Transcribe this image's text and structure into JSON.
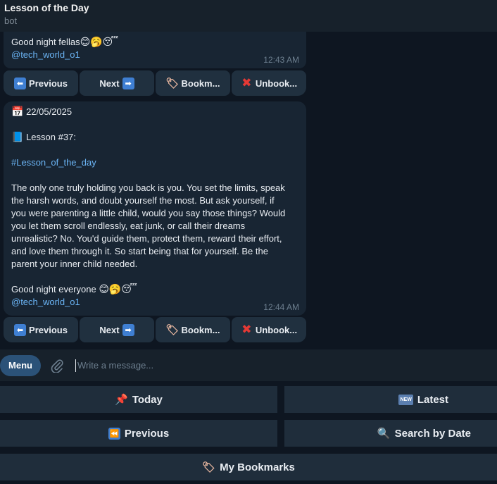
{
  "header": {
    "title": "Lesson of the Day",
    "subtitle": "bot"
  },
  "messages": [
    {
      "lines": [
        "Good night fellas"
      ],
      "emoji": "😊🥱😴",
      "mention": "@tech_world_o1",
      "time": "12:43 AM"
    },
    {
      "date_emoji": "📅",
      "date": "22/05/2025",
      "lesson_emoji": "📘",
      "lesson": "Lesson #37:",
      "hashtag": "#Lesson_of_the_day",
      "body": [
        "The only one truly holding you back is you. You set the limits, speak",
        "the harsh words, and doubt yourself the most. But ask yourself, if",
        "you were parenting a little child, would you say those things? Would",
        "you let them scroll endlessly, eat junk, or call their dreams",
        "unrealistic? No. You'd guide them, protect them, reward their effort,",
        "and love them through it. So start being that for yourself. Be the",
        "parent your inner child needed."
      ],
      "closing": "Good night everyone ",
      "closing_emoji": "😊🥱😴",
      "mention": "@tech_world_o1",
      "time": "12:44 AM"
    }
  ],
  "inline_keyboard": {
    "previous": "Previous",
    "next": "Next",
    "bookmark": "Bookm...",
    "unbookmark": "Unbook...",
    "previous_icon": "left-arrow-icon",
    "next_icon": "right-arrow-icon",
    "bookmark_icon": "bookmark-tag-icon",
    "unbookmark_icon": "red-x-icon"
  },
  "input": {
    "menu": "Menu",
    "placeholder": "Write a message..."
  },
  "reply_keyboard": {
    "today": "Today",
    "latest": "Latest",
    "previous": "Previous",
    "search": "Search by Date",
    "bookmarks": "My Bookmarks",
    "today_icon": "pushpin-icon",
    "latest_icon": "new-badge-icon",
    "latest_badge": "NEW",
    "previous_icon": "rewind-icon",
    "search_icon": "magnifier-icon",
    "bookmarks_icon": "bookmark-tag-icon"
  },
  "colors": {
    "background": "#0e1621",
    "bubble": "#182533",
    "link": "#6ab3f3",
    "menu_button": "#2b5278",
    "button": "#20303f"
  }
}
